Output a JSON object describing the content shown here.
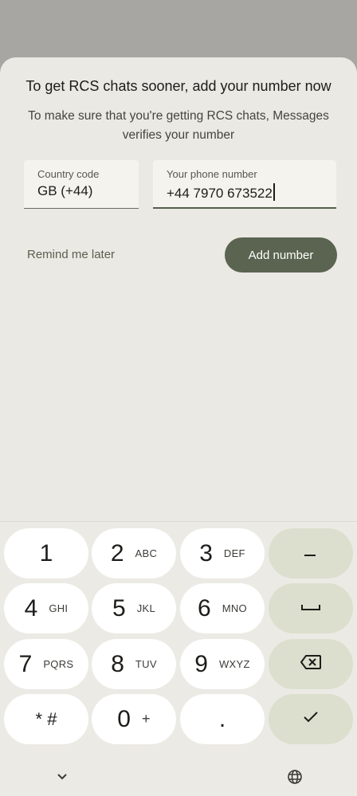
{
  "dialog": {
    "title": "To get RCS chats sooner, add your number now",
    "subtitle": "To make sure that you're getting RCS chats, Messages verifies your number"
  },
  "country_field": {
    "label": "Country code",
    "value": "GB (+44)"
  },
  "phone_field": {
    "label": "Your phone number",
    "value": "+44 7970 673522"
  },
  "actions": {
    "remind_label": "Remind me later",
    "add_label": "Add number"
  },
  "keypad": {
    "rows": [
      [
        {
          "main": "1",
          "sub": ""
        },
        {
          "main": "2",
          "sub": "ABC"
        },
        {
          "main": "3",
          "sub": "DEF"
        },
        {
          "icon": "minus-icon",
          "symbol": "–"
        }
      ],
      [
        {
          "main": "4",
          "sub": "GHI"
        },
        {
          "main": "5",
          "sub": "JKL"
        },
        {
          "main": "6",
          "sub": "MNO"
        },
        {
          "icon": "space-icon",
          "symbol": "␣"
        }
      ],
      [
        {
          "main": "7",
          "sub": "PQRS"
        },
        {
          "main": "8",
          "sub": "TUV"
        },
        {
          "main": "9",
          "sub": "WXYZ"
        },
        {
          "icon": "backspace-icon",
          "symbol": "⌫"
        }
      ],
      [
        {
          "main": "* #",
          "sub": ""
        },
        {
          "main": "0",
          "sub": "+"
        },
        {
          "main": ".",
          "sub": ""
        },
        {
          "icon": "check-icon",
          "symbol": "✓"
        }
      ]
    ]
  },
  "nav": {
    "left_icon": "chevron-down-icon",
    "right_icon": "globe-icon"
  },
  "colors": {
    "accent": "#5a6450",
    "sheet": "#ebe9e4",
    "function_key": "#dcdfce"
  }
}
